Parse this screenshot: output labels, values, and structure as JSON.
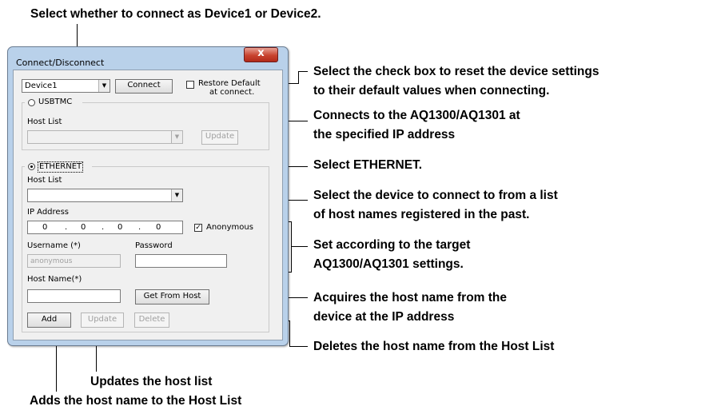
{
  "dialog": {
    "title": "Connect/Disconnect",
    "close_label": "x",
    "device_select": {
      "value": "Device1"
    },
    "connect_label": "Connect",
    "restore_default": {
      "label_line1": "Restore Default",
      "label_line2": "at connect.",
      "checked": false
    },
    "usbtmc": {
      "label": "USBTMC",
      "selected": false,
      "host_list_label": "Host List",
      "host_list_value": "",
      "update_label": "Update"
    },
    "ethernet": {
      "label": "ETHERNET",
      "selected": true,
      "host_list_label": "Host List",
      "host_list_value": "",
      "ip_label": "IP Address",
      "ip": [
        "0",
        "0",
        "0",
        "0"
      ],
      "ip_dot": ".",
      "anonymous_label": "Anonymous",
      "anonymous_checked": true,
      "username_label": "Username (*)",
      "username_value": "anonymous",
      "password_label": "Password",
      "password_value": "",
      "hostname_label": "Host Name(*)",
      "hostname_value": "",
      "get_from_host_label": "Get From Host",
      "add_label": "Add",
      "update_label": "Update",
      "delete_label": "Delete"
    }
  },
  "annotations": {
    "top": "Select whether to connect as Device1 or Device2.",
    "restore_1": "Select the check box to reset the device settings",
    "restore_2": "to their default values when connecting.",
    "connect_1": "Connects to the AQ1300/AQ1301 at",
    "connect_2": "the specified IP address",
    "ethernet": "Select ETHERNET.",
    "hostlist_1": "Select the device to connect to from a list",
    "hostlist_2": "of host names registered in the past.",
    "settings_1": "Set according to the target",
    "settings_2": "AQ1300/AQ1301 settings.",
    "gethost_1": "Acquires the host name from the",
    "gethost_2": "device at the IP address",
    "delete": "Deletes the host name from the Host List",
    "update": "Updates the host list",
    "add": "Adds the host name to the Host List"
  }
}
